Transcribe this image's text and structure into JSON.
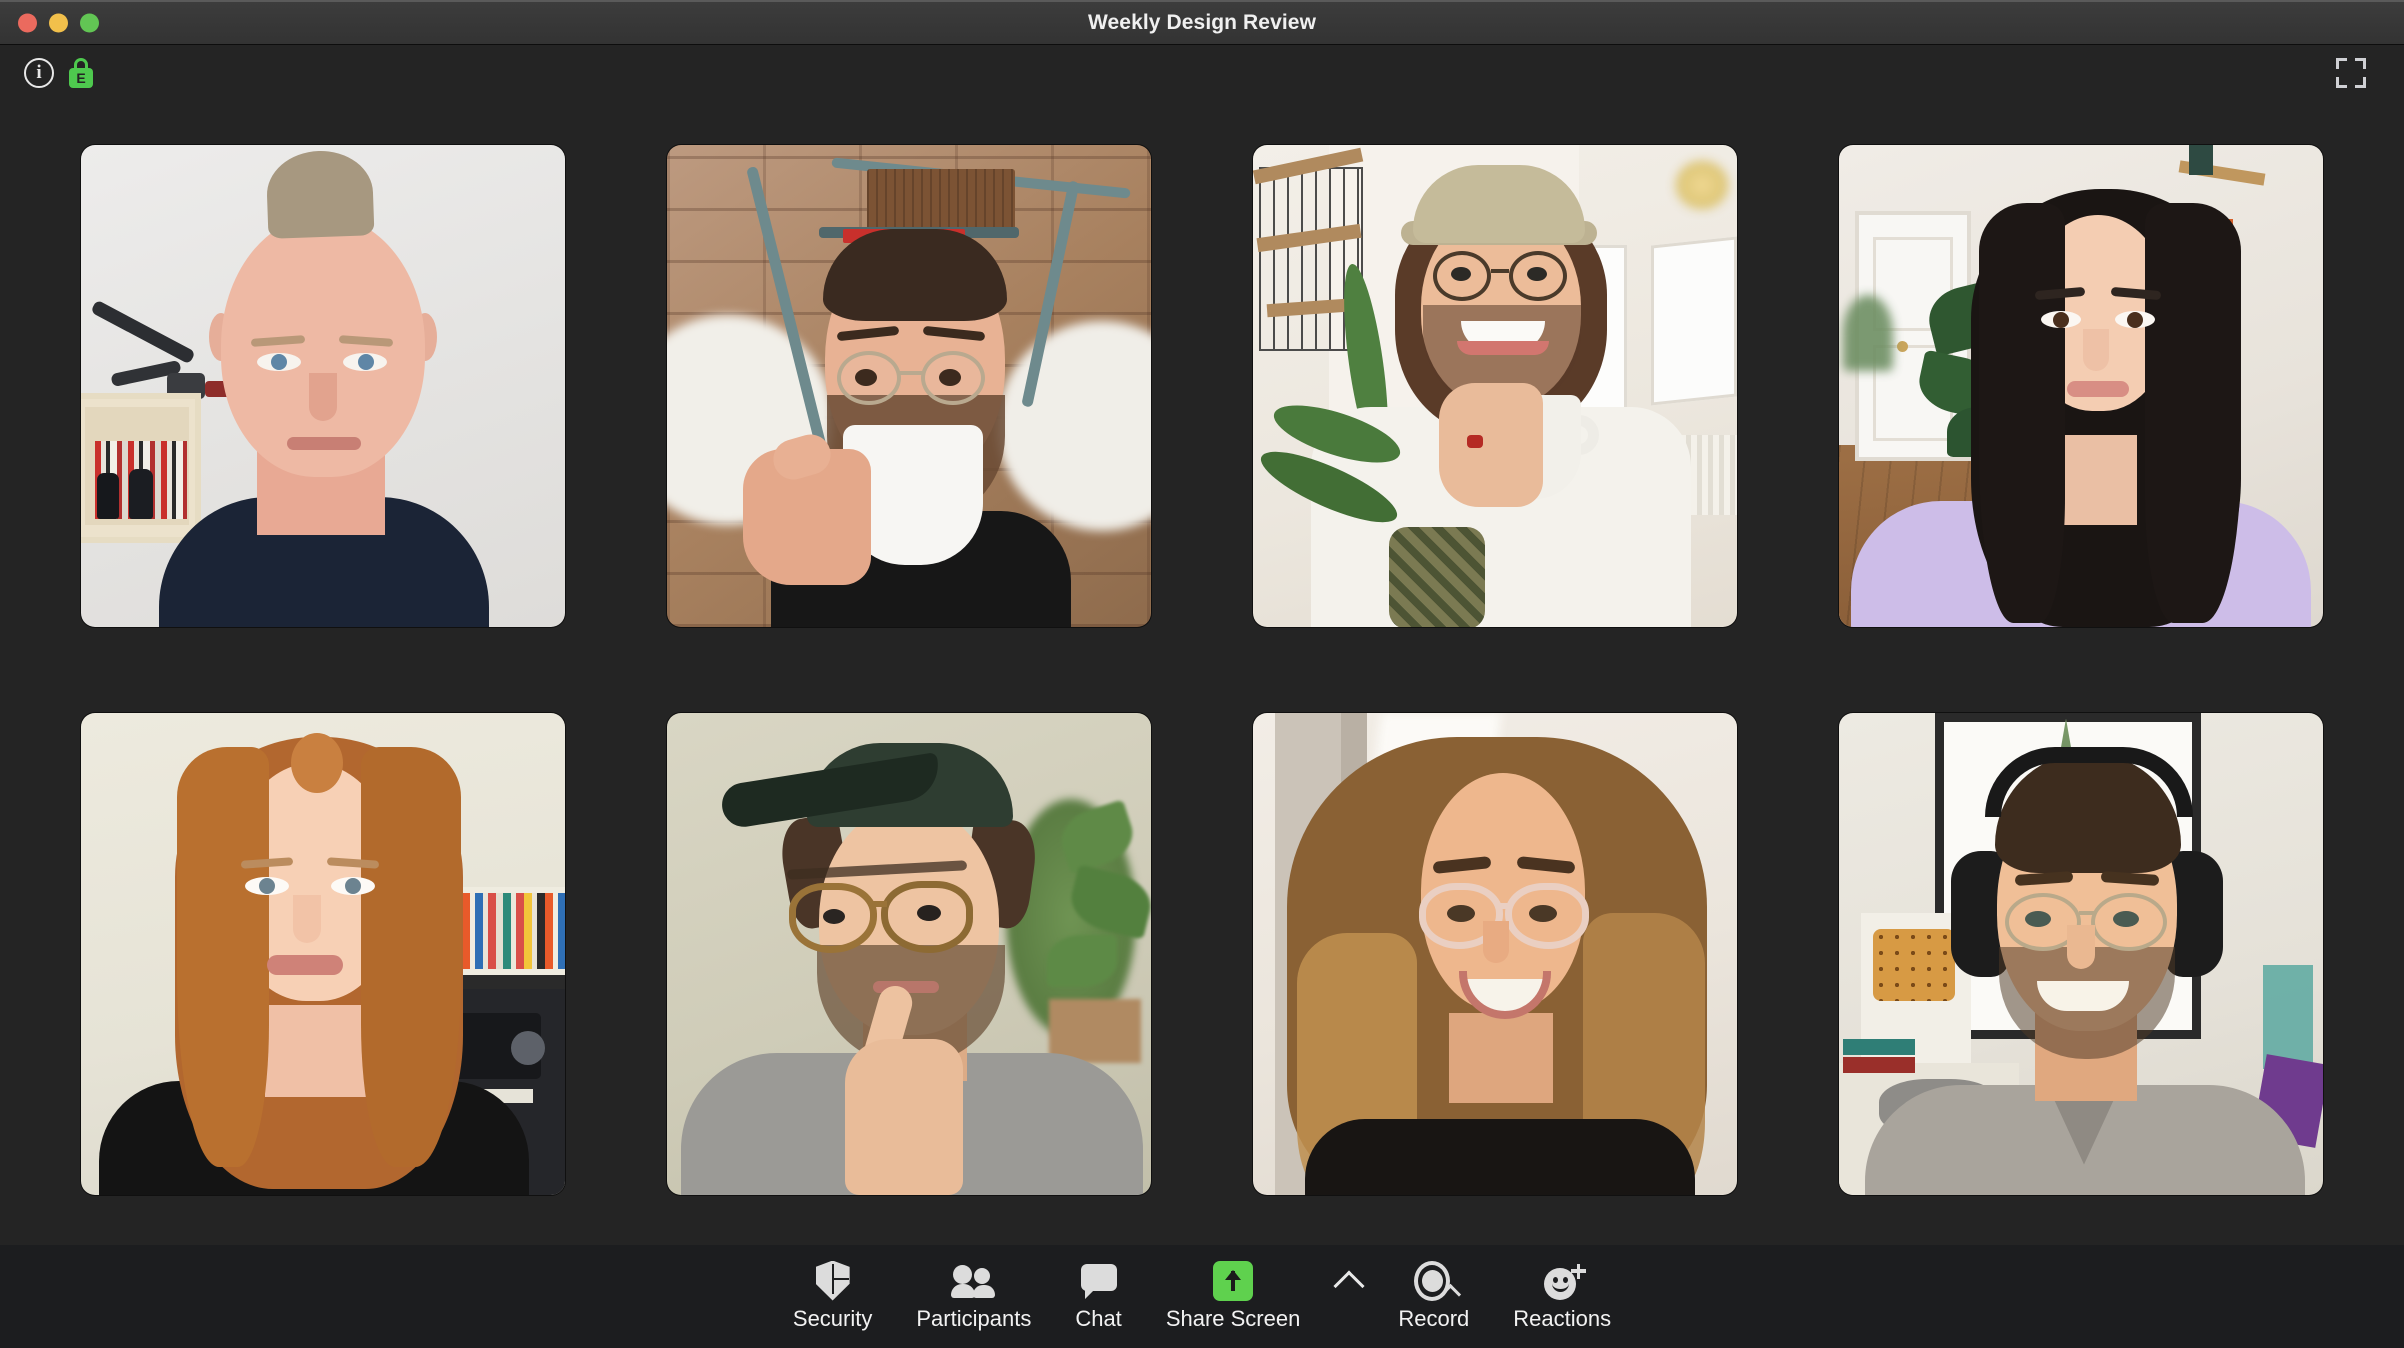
{
  "window": {
    "title": "Weekly Design Review",
    "traffic_lights": [
      {
        "name": "close",
        "color": "#eb6a5e"
      },
      {
        "name": "minimize",
        "color": "#f2c04b"
      },
      {
        "name": "zoom",
        "color": "#62c554"
      }
    ]
  },
  "topbar": {
    "info_icon": "info-icon",
    "info_glyph": "i",
    "encryption_icon": "lock-icon",
    "encryption_glyph": "E",
    "encryption_color": "#4ec94e",
    "fullscreen_icon": "fullscreen-icon"
  },
  "gallery": {
    "layout": "4x2-grid",
    "participant_count": 8,
    "tiles": [
      {
        "id": 1,
        "position": "row1-col1",
        "description": "man-with-mohawk"
      },
      {
        "id": 2,
        "position": "row1-col2",
        "description": "man-drinking-coffee"
      },
      {
        "id": 3,
        "position": "row1-col3",
        "description": "man-with-cap-holding-mug"
      },
      {
        "id": 4,
        "position": "row1-col4",
        "description": "woman-with-long-dark-hair"
      },
      {
        "id": 5,
        "position": "row2-col1",
        "description": "woman-with-red-hair"
      },
      {
        "id": 6,
        "position": "row2-col2",
        "description": "man-with-cap-and-glasses"
      },
      {
        "id": 7,
        "position": "row2-col3",
        "description": "woman-with-curly-hair"
      },
      {
        "id": 8,
        "position": "row2-col4",
        "description": "man-with-headphones"
      }
    ]
  },
  "toolbar": {
    "background": "#1c1d1f",
    "accent_green": "#5fd14e",
    "items": [
      {
        "label": "Security",
        "icon": "shield-icon"
      },
      {
        "label": "Participants",
        "icon": "people-icon"
      },
      {
        "label": "Chat",
        "icon": "chat-bubble-icon"
      },
      {
        "label": "Share Screen",
        "icon": "share-screen-up-arrow-icon"
      },
      {
        "label": "Record",
        "icon": "record-circle-icon"
      },
      {
        "label": "Reactions",
        "icon": "smiley-plus-icon"
      }
    ],
    "share_screen_options_chevron": "chevron-up-icon"
  }
}
